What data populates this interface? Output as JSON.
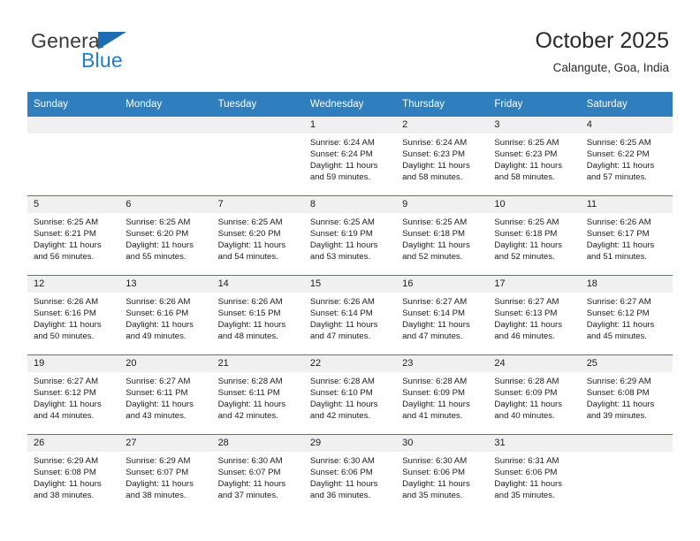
{
  "logo": {
    "line1": "General",
    "line2": "Blue",
    "triangle_color": "#1b6cb5",
    "blue_color": "#1b7fd4",
    "general_color": "#3b3b3b"
  },
  "header": {
    "title": "October 2025",
    "subtitle": "Calangute, Goa, India"
  },
  "theme": {
    "header_blue": "#2f7ebd",
    "daynum_band": "#f0f0f0",
    "text": "#1c1c1c"
  },
  "calendar": {
    "weekday_headers": [
      "Sunday",
      "Monday",
      "Tuesday",
      "Wednesday",
      "Thursday",
      "Friday",
      "Saturday"
    ],
    "weeks": [
      [
        {
          "day": "",
          "lines": []
        },
        {
          "day": "",
          "lines": []
        },
        {
          "day": "",
          "lines": []
        },
        {
          "day": "1",
          "lines": [
            "Sunrise: 6:24 AM",
            "Sunset: 6:24 PM",
            "Daylight: 11 hours",
            "and 59 minutes."
          ]
        },
        {
          "day": "2",
          "lines": [
            "Sunrise: 6:24 AM",
            "Sunset: 6:23 PM",
            "Daylight: 11 hours",
            "and 58 minutes."
          ]
        },
        {
          "day": "3",
          "lines": [
            "Sunrise: 6:25 AM",
            "Sunset: 6:23 PM",
            "Daylight: 11 hours",
            "and 58 minutes."
          ]
        },
        {
          "day": "4",
          "lines": [
            "Sunrise: 6:25 AM",
            "Sunset: 6:22 PM",
            "Daylight: 11 hours",
            "and 57 minutes."
          ]
        }
      ],
      [
        {
          "day": "5",
          "lines": [
            "Sunrise: 6:25 AM",
            "Sunset: 6:21 PM",
            "Daylight: 11 hours",
            "and 56 minutes."
          ]
        },
        {
          "day": "6",
          "lines": [
            "Sunrise: 6:25 AM",
            "Sunset: 6:20 PM",
            "Daylight: 11 hours",
            "and 55 minutes."
          ]
        },
        {
          "day": "7",
          "lines": [
            "Sunrise: 6:25 AM",
            "Sunset: 6:20 PM",
            "Daylight: 11 hours",
            "and 54 minutes."
          ]
        },
        {
          "day": "8",
          "lines": [
            "Sunrise: 6:25 AM",
            "Sunset: 6:19 PM",
            "Daylight: 11 hours",
            "and 53 minutes."
          ]
        },
        {
          "day": "9",
          "lines": [
            "Sunrise: 6:25 AM",
            "Sunset: 6:18 PM",
            "Daylight: 11 hours",
            "and 52 minutes."
          ]
        },
        {
          "day": "10",
          "lines": [
            "Sunrise: 6:25 AM",
            "Sunset: 6:18 PM",
            "Daylight: 11 hours",
            "and 52 minutes."
          ]
        },
        {
          "day": "11",
          "lines": [
            "Sunrise: 6:26 AM",
            "Sunset: 6:17 PM",
            "Daylight: 11 hours",
            "and 51 minutes."
          ]
        }
      ],
      [
        {
          "day": "12",
          "lines": [
            "Sunrise: 6:26 AM",
            "Sunset: 6:16 PM",
            "Daylight: 11 hours",
            "and 50 minutes."
          ]
        },
        {
          "day": "13",
          "lines": [
            "Sunrise: 6:26 AM",
            "Sunset: 6:16 PM",
            "Daylight: 11 hours",
            "and 49 minutes."
          ]
        },
        {
          "day": "14",
          "lines": [
            "Sunrise: 6:26 AM",
            "Sunset: 6:15 PM",
            "Daylight: 11 hours",
            "and 48 minutes."
          ]
        },
        {
          "day": "15",
          "lines": [
            "Sunrise: 6:26 AM",
            "Sunset: 6:14 PM",
            "Daylight: 11 hours",
            "and 47 minutes."
          ]
        },
        {
          "day": "16",
          "lines": [
            "Sunrise: 6:27 AM",
            "Sunset: 6:14 PM",
            "Daylight: 11 hours",
            "and 47 minutes."
          ]
        },
        {
          "day": "17",
          "lines": [
            "Sunrise: 6:27 AM",
            "Sunset: 6:13 PM",
            "Daylight: 11 hours",
            "and 46 minutes."
          ]
        },
        {
          "day": "18",
          "lines": [
            "Sunrise: 6:27 AM",
            "Sunset: 6:12 PM",
            "Daylight: 11 hours",
            "and 45 minutes."
          ]
        }
      ],
      [
        {
          "day": "19",
          "lines": [
            "Sunrise: 6:27 AM",
            "Sunset: 6:12 PM",
            "Daylight: 11 hours",
            "and 44 minutes."
          ]
        },
        {
          "day": "20",
          "lines": [
            "Sunrise: 6:27 AM",
            "Sunset: 6:11 PM",
            "Daylight: 11 hours",
            "and 43 minutes."
          ]
        },
        {
          "day": "21",
          "lines": [
            "Sunrise: 6:28 AM",
            "Sunset: 6:11 PM",
            "Daylight: 11 hours",
            "and 42 minutes."
          ]
        },
        {
          "day": "22",
          "lines": [
            "Sunrise: 6:28 AM",
            "Sunset: 6:10 PM",
            "Daylight: 11 hours",
            "and 42 minutes."
          ]
        },
        {
          "day": "23",
          "lines": [
            "Sunrise: 6:28 AM",
            "Sunset: 6:09 PM",
            "Daylight: 11 hours",
            "and 41 minutes."
          ]
        },
        {
          "day": "24",
          "lines": [
            "Sunrise: 6:28 AM",
            "Sunset: 6:09 PM",
            "Daylight: 11 hours",
            "and 40 minutes."
          ]
        },
        {
          "day": "25",
          "lines": [
            "Sunrise: 6:29 AM",
            "Sunset: 6:08 PM",
            "Daylight: 11 hours",
            "and 39 minutes."
          ]
        }
      ],
      [
        {
          "day": "26",
          "lines": [
            "Sunrise: 6:29 AM",
            "Sunset: 6:08 PM",
            "Daylight: 11 hours",
            "and 38 minutes."
          ]
        },
        {
          "day": "27",
          "lines": [
            "Sunrise: 6:29 AM",
            "Sunset: 6:07 PM",
            "Daylight: 11 hours",
            "and 38 minutes."
          ]
        },
        {
          "day": "28",
          "lines": [
            "Sunrise: 6:30 AM",
            "Sunset: 6:07 PM",
            "Daylight: 11 hours",
            "and 37 minutes."
          ]
        },
        {
          "day": "29",
          "lines": [
            "Sunrise: 6:30 AM",
            "Sunset: 6:06 PM",
            "Daylight: 11 hours",
            "and 36 minutes."
          ]
        },
        {
          "day": "30",
          "lines": [
            "Sunrise: 6:30 AM",
            "Sunset: 6:06 PM",
            "Daylight: 11 hours",
            "and 35 minutes."
          ]
        },
        {
          "day": "31",
          "lines": [
            "Sunrise: 6:31 AM",
            "Sunset: 6:06 PM",
            "Daylight: 11 hours",
            "and 35 minutes."
          ]
        },
        {
          "day": "",
          "lines": []
        }
      ]
    ]
  }
}
